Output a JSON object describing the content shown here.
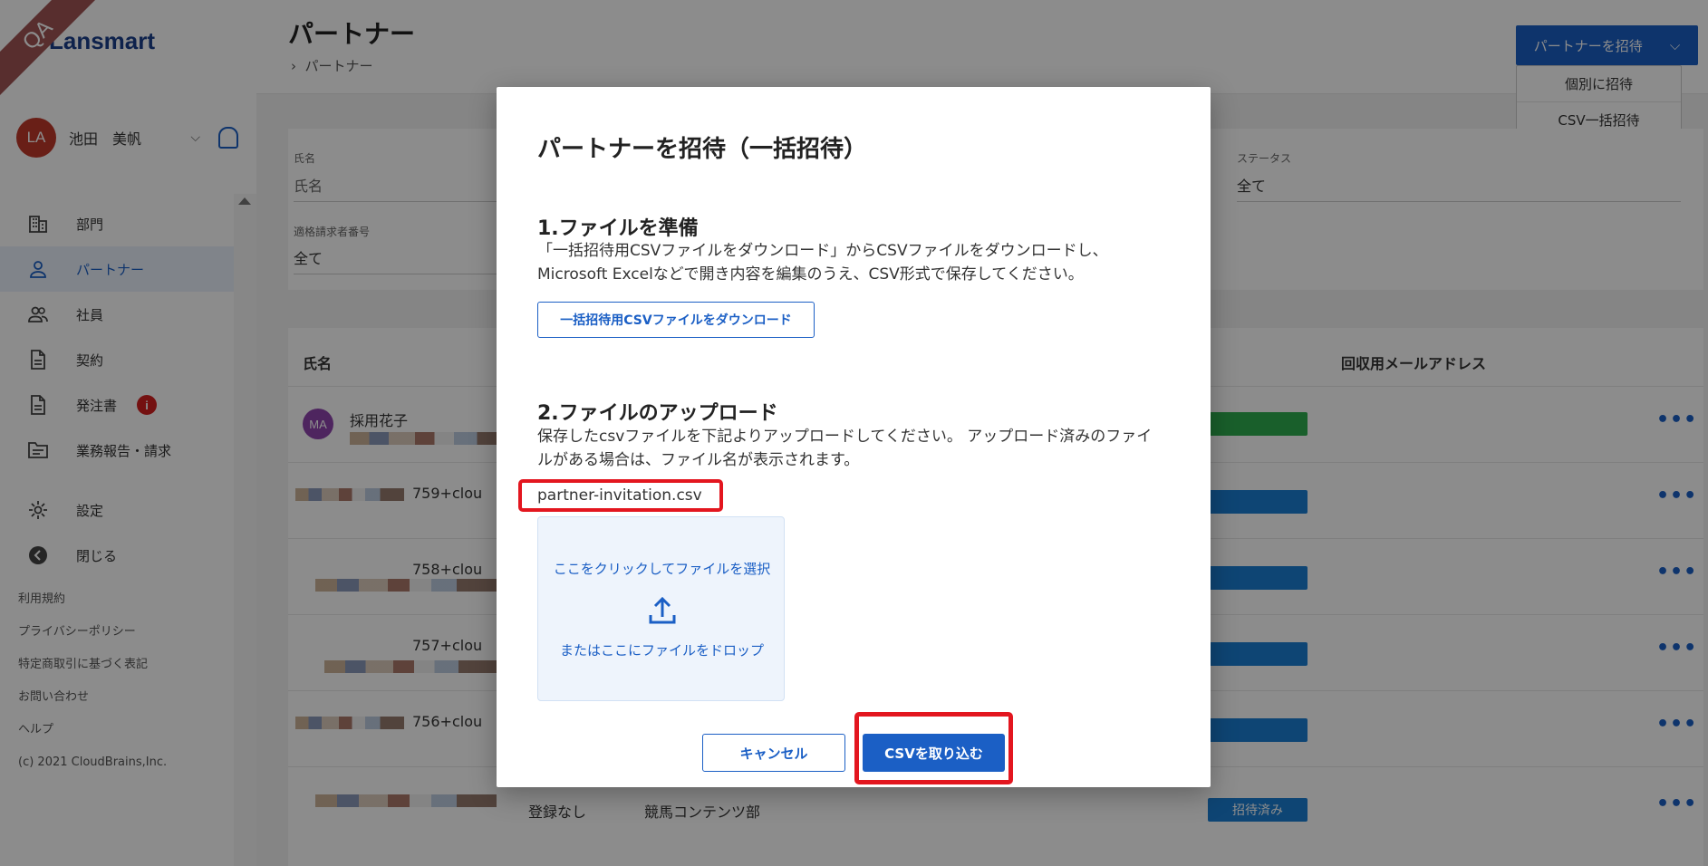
{
  "ribbon": "QA",
  "brand": {
    "name": "Lansmart"
  },
  "user": {
    "initials": "LA",
    "name": "池田　美帆"
  },
  "nav": {
    "items": [
      {
        "label": "部門",
        "icon": "building-icon"
      },
      {
        "label": "パートナー",
        "icon": "person-icon",
        "active": true
      },
      {
        "label": "社員",
        "icon": "people-icon"
      },
      {
        "label": "契約",
        "icon": "document-icon"
      },
      {
        "label": "発注書",
        "icon": "document-icon",
        "badge": "i"
      },
      {
        "label": "業務報告・請求",
        "icon": "folder-icon"
      }
    ],
    "settings": "設定",
    "close": "閉じる"
  },
  "footer": {
    "terms": "利用規約",
    "privacy": "プライバシーポリシー",
    "commercial": "特定商取引に基づく表記",
    "contact": "お問い合わせ",
    "help": "ヘルプ",
    "copyright": "(c) 2021 CloudBrains,Inc."
  },
  "header": {
    "title": "パートナー",
    "breadcrumb": "パートナー",
    "invite_button": "パートナーを招待",
    "dropdown": {
      "individual": "個別に招待",
      "csv": "CSV一括招待"
    }
  },
  "filters": {
    "name_label": "氏名",
    "name_placeholder": "氏名",
    "status_label": "ステータス",
    "status_value": "全て",
    "invoice_label": "適格請求者番号",
    "invoice_value": "全て"
  },
  "table": {
    "col_name": "氏名",
    "col_email": "回収用メールアドレス",
    "rows": [
      {
        "initials": "MA",
        "name": "採用花子",
        "status": ""
      },
      {
        "name": "759+clou",
        "status": ""
      },
      {
        "name": "758+clou",
        "status": ""
      },
      {
        "name": "757+clou",
        "status": ""
      },
      {
        "name": "756+clou",
        "status": ""
      },
      {
        "name": "",
        "cell1": "登録なし",
        "cell2": "競馬コンテンツ部",
        "status": "招待済み"
      }
    ],
    "more": "•••"
  },
  "modal": {
    "title": "パートナーを招待（一括招待）",
    "step1_title": "1.ファイルを準備",
    "step1_desc": "「一括招待用CSVファイルをダウンロード」からCSVファイルをダウンロードし、Microsoft Excelなどで開き内容を編集のうえ、CSV形式で保存してください。",
    "download_button": "一括招待用CSVファイルをダウンロード",
    "step2_title": "2.ファイルのアップロード",
    "step2_desc": "保存したcsvファイルを下記よりアップロードしてください。 アップロード済みのファイルがある場合は、ファイル名が表示されます。",
    "file_name": "partner-invitation.csv",
    "dropzone_click": "ここをクリックしてファイルを選択",
    "dropzone_icon": "upload-icon",
    "dropzone_drop": "またはここにファイルをドロップ",
    "cancel_button": "キャンセル",
    "submit_button": "CSVを取り込む"
  },
  "colors": {
    "primary": "#1b5fc5",
    "highlight": "#e3161f",
    "brand": "#1b3f8b"
  }
}
